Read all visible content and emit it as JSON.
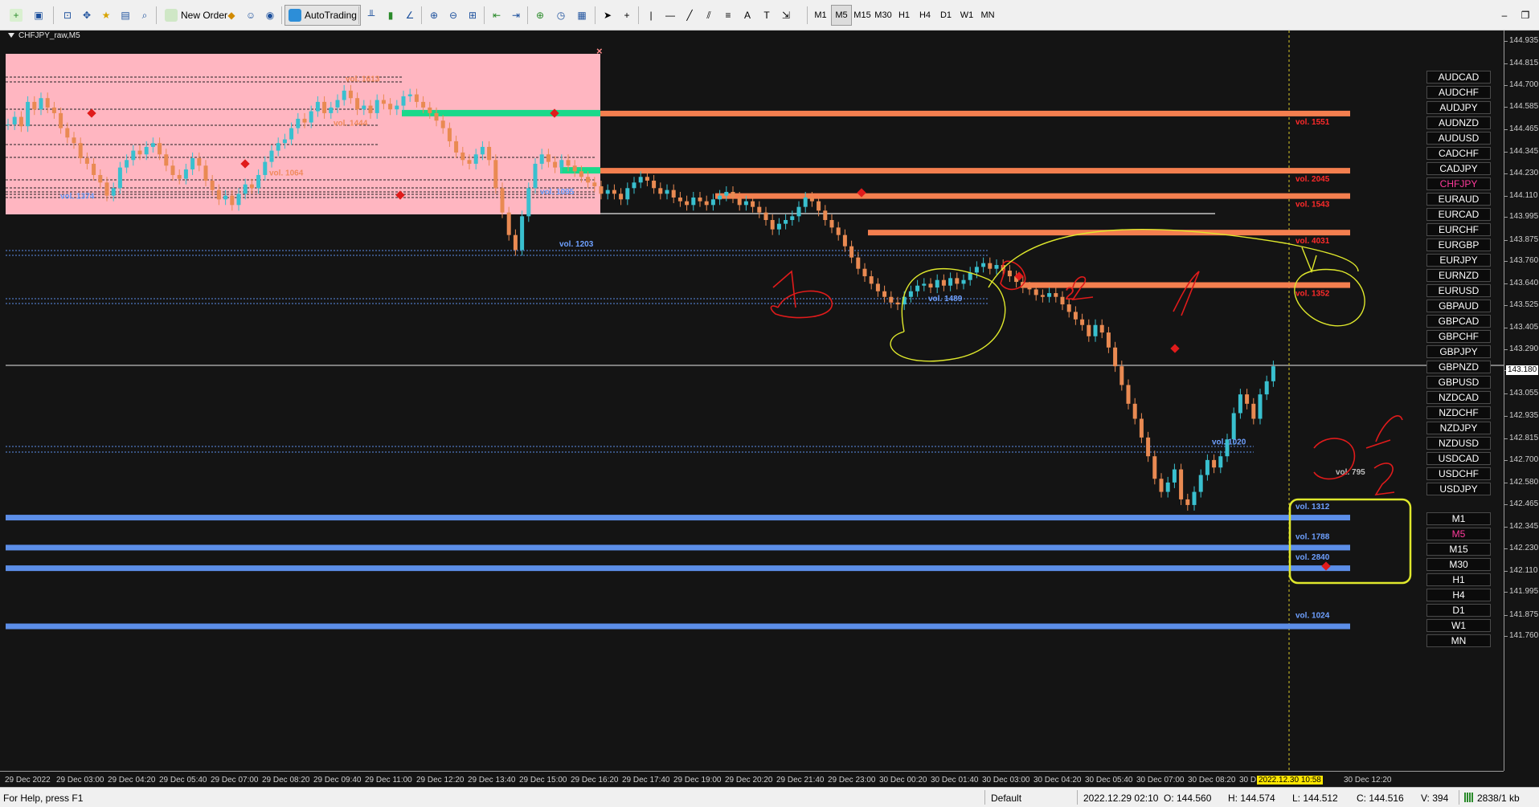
{
  "toolbar": {
    "new_order": "New Order",
    "auto_trading": "AutoTrading",
    "timeframes": [
      "M1",
      "M5",
      "M15",
      "M30",
      "H1",
      "H4",
      "D1",
      "W1",
      "MN"
    ],
    "active_timeframe": "M5"
  },
  "chart": {
    "title": "CHFJPY_raw,M5",
    "close_symbol": "×",
    "price_labels": [
      "144.935",
      "144.815",
      "144.700",
      "144.585",
      "144.465",
      "144.345",
      "144.230",
      "144.110",
      "143.995",
      "143.875",
      "143.760",
      "143.640",
      "143.525",
      "143.405",
      "143.290",
      "143.180",
      "143.055",
      "142.935",
      "142.815",
      "142.700",
      "142.580",
      "142.465",
      "142.345",
      "142.230",
      "142.110",
      "141.995",
      "141.875",
      "141.760"
    ],
    "current_price": "143.180",
    "time_labels": [
      "29 Dec 2022",
      "29 Dec 03:00",
      "29 Dec 04:20",
      "29 Dec 05:40",
      "29 Dec 07:00",
      "29 Dec 08:20",
      "29 Dec 09:40",
      "29 Dec 11:00",
      "29 Dec 12:20",
      "29 Dec 13:40",
      "29 Dec 15:00",
      "29 Dec 16:20",
      "29 Dec 17:40",
      "29 Dec 19:00",
      "29 Dec 20:20",
      "29 Dec 21:40",
      "29 Dec 23:00",
      "30 Dec 00:20",
      "30 Dec 01:40",
      "30 Dec 03:00",
      "30 Dec 04:20",
      "30 Dec 05:40",
      "30 Dec 07:00",
      "30 Dec 08:20",
      "30 D",
      "2022.12.30 10:58",
      "30 Dec 12:20"
    ],
    "highlight_time_index": 25,
    "colors": {
      "background": "#141414",
      "bull": "#39c0cf",
      "bear": "#e98a52",
      "resistance": "#f47f4f",
      "support": "#5c8ee8",
      "zone": "#ffb6c1",
      "green_zone": "#19d98a",
      "annotation_red": "#e01b1b",
      "annotation_yellow": "#dfe82c"
    }
  },
  "candles": [
    144.49,
    144.53,
    144.48,
    144.61,
    144.57,
    144.63,
    144.58,
    144.55,
    144.47,
    144.42,
    144.39,
    144.31,
    144.28,
    144.22,
    144.18,
    144.11,
    144.15,
    144.26,
    144.3,
    144.35,
    144.33,
    144.37,
    144.39,
    144.33,
    144.27,
    144.22,
    144.2,
    144.25,
    144.31,
    144.27,
    144.19,
    144.14,
    144.09,
    144.11,
    144.06,
    144.12,
    144.17,
    144.15,
    144.22,
    144.29,
    144.35,
    144.39,
    144.41,
    144.47,
    144.52,
    144.5,
    144.56,
    144.61,
    144.55,
    144.58,
    144.62,
    144.67,
    144.63,
    144.57,
    144.59,
    144.55,
    144.62,
    144.6,
    144.57,
    144.59,
    144.64,
    144.65,
    144.61,
    144.58,
    144.55,
    144.51,
    144.47,
    144.4,
    144.34,
    144.3,
    144.28,
    144.33,
    144.37,
    144.3,
    144.15,
    144.02,
    143.9,
    143.82,
    144.0,
    144.15,
    144.28,
    144.33,
    144.29,
    144.26,
    144.3,
    144.27,
    144.24,
    144.21,
    144.18,
    144.16,
    144.12,
    144.14,
    144.12,
    144.09,
    144.15,
    144.18,
    144.21,
    144.19,
    144.15,
    144.12,
    144.14,
    144.1,
    144.08,
    144.06,
    144.1,
    144.08,
    144.06,
    144.09,
    144.11,
    144.13,
    144.1,
    144.06,
    144.08,
    144.05,
    144.02,
    143.98,
    143.93,
    143.96,
    143.98,
    144.0,
    144.05,
    144.1,
    144.08,
    144.03,
    143.98,
    143.94,
    143.9,
    143.84,
    143.78,
    143.72,
    143.68,
    143.64,
    143.6,
    143.57,
    143.54,
    143.53,
    143.57,
    143.6,
    143.63,
    143.64,
    143.62,
    143.66,
    143.63,
    143.67,
    143.64,
    143.66,
    143.7,
    143.73,
    143.75,
    143.72,
    143.74,
    143.71,
    143.68,
    143.65,
    143.62,
    143.61,
    143.58,
    143.57,
    143.59,
    143.57,
    143.53,
    143.49,
    143.45,
    143.42,
    143.36,
    143.42,
    143.38,
    143.3,
    143.2,
    143.1,
    143.0,
    142.92,
    142.82,
    142.72,
    142.6,
    142.53,
    142.58,
    142.65,
    142.49,
    142.46,
    142.53,
    142.62,
    142.7,
    142.66,
    142.72,
    142.81,
    142.95,
    143.05,
    143.0,
    142.92,
    143.05,
    143.12,
    143.2
  ],
  "levels": [
    {
      "vol": "vol. 1551",
      "price": 144.55,
      "type": "resistance"
    },
    {
      "vol": "vol. 2045",
      "price": 144.245,
      "type": "resistance"
    },
    {
      "vol": "vol. 1543",
      "price": 144.11,
      "type": "resistance"
    },
    {
      "vol": "vol. 4031",
      "price": 143.915,
      "type": "resistance"
    },
    {
      "vol": "vol. 1352",
      "price": 143.635,
      "type": "resistance"
    },
    {
      "vol": "vol. 1312",
      "price": 142.395,
      "type": "support"
    },
    {
      "vol": "vol. 1788",
      "price": 142.235,
      "type": "support"
    },
    {
      "vol": "vol. 2840",
      "price": 142.125,
      "type": "support"
    },
    {
      "vol": "vol. 1024",
      "price": 141.815,
      "type": "support"
    }
  ],
  "aux_labels": [
    {
      "text": "vol. 1613",
      "price": 144.735,
      "type": "zone"
    },
    {
      "text": "vol. 1444",
      "price": 144.5,
      "type": "zone"
    },
    {
      "text": "vol. 1064",
      "price": 144.235,
      "type": "zone"
    },
    {
      "text": "vol. 1095",
      "price": 144.135,
      "type": "blue"
    },
    {
      "text": "vol. 1374",
      "price": 144.11,
      "type": "blue"
    },
    {
      "text": "vol. 1203",
      "price": 143.855,
      "type": "blue"
    },
    {
      "text": "vol. 1489",
      "price": 143.565,
      "type": "blue"
    },
    {
      "text": "vol. 1020",
      "price": 142.8,
      "type": "blue"
    },
    {
      "text": "vol. 795",
      "price": 142.64,
      "type": "gray"
    }
  ],
  "annotations": {
    "one": "1",
    "two": "2"
  },
  "symbols": [
    "AUDCAD",
    "AUDCHF",
    "AUDJPY",
    "AUDNZD",
    "AUDUSD",
    "CADCHF",
    "CADJPY",
    "CHFJPY",
    "EURAUD",
    "EURCAD",
    "EURCHF",
    "EURGBP",
    "EURJPY",
    "EURNZD",
    "EURUSD",
    "GBPAUD",
    "GBPCAD",
    "GBPCHF",
    "GBPJPY",
    "GBPNZD",
    "GBPUSD",
    "NZDCAD",
    "NZDCHF",
    "NZDJPY",
    "NZDUSD",
    "USDCAD",
    "USDCHF",
    "USDJPY"
  ],
  "selected_symbol": "CHFJPY",
  "panel_timeframes": [
    "M1",
    "M5",
    "M15",
    "M30",
    "H1",
    "H4",
    "D1",
    "W1",
    "MN"
  ],
  "selected_panel_tf": "M5",
  "status": {
    "help": "For Help, press F1",
    "profile": "Default",
    "time": "2022.12.29 02:10",
    "open": "O: 144.560",
    "high": "H: 144.574",
    "low": "L: 144.512",
    "close": "C: 144.516",
    "volume": "V: 394",
    "traffic": "2838/1 kb"
  }
}
